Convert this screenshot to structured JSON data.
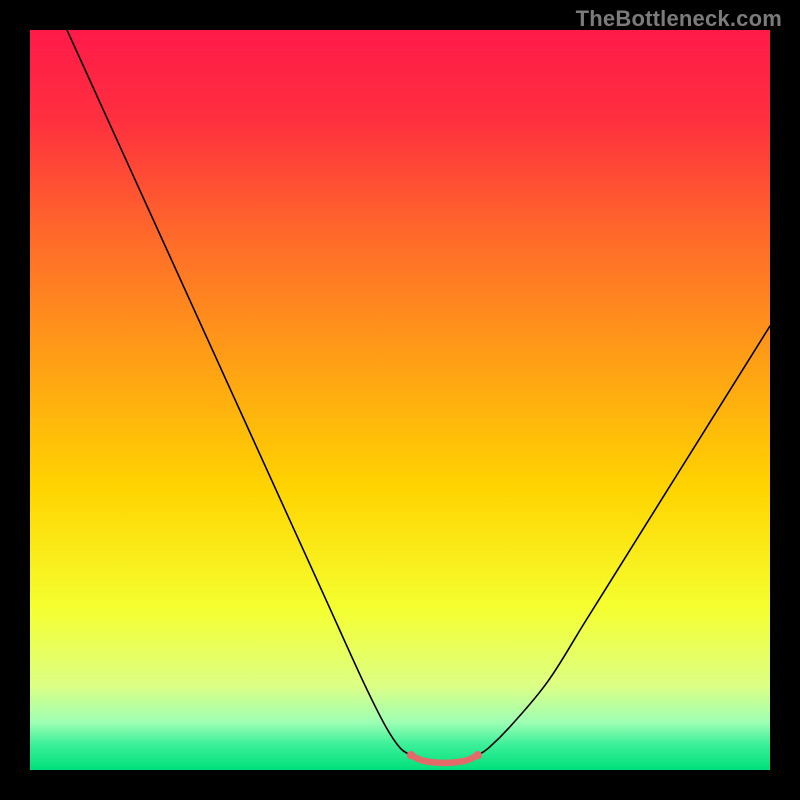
{
  "watermark": "TheBottleneck.com",
  "chart_data": {
    "type": "line",
    "title": "",
    "xlabel": "",
    "ylabel": "",
    "xlim": [
      0,
      100
    ],
    "ylim": [
      0,
      100
    ],
    "gradient_stops": [
      {
        "offset": 0.0,
        "color": "#ff1a49"
      },
      {
        "offset": 0.12,
        "color": "#ff2f3f"
      },
      {
        "offset": 0.28,
        "color": "#ff6a2a"
      },
      {
        "offset": 0.45,
        "color": "#ffa015"
      },
      {
        "offset": 0.62,
        "color": "#ffd400"
      },
      {
        "offset": 0.78,
        "color": "#f5ff2f"
      },
      {
        "offset": 0.885,
        "color": "#ddff84"
      },
      {
        "offset": 0.935,
        "color": "#9fffb4"
      },
      {
        "offset": 0.965,
        "color": "#3df09a"
      },
      {
        "offset": 1.0,
        "color": "#00e07a"
      }
    ],
    "series": [
      {
        "name": "bottleneck-curve-left",
        "color": "#000000",
        "width": 1.6,
        "x": [
          5,
          10,
          15,
          20,
          25,
          30,
          35,
          40,
          45,
          48,
          50,
          51.5
        ],
        "y": [
          100,
          89,
          78,
          67,
          56,
          45,
          34,
          23,
          12,
          6,
          3,
          2
        ]
      },
      {
        "name": "bottleneck-curve-right",
        "color": "#000000",
        "width": 1.6,
        "x": [
          60.5,
          62,
          65,
          70,
          75,
          80,
          85,
          90,
          95,
          100
        ],
        "y": [
          2,
          3,
          6,
          12,
          20,
          28,
          36,
          44,
          52,
          60
        ]
      },
      {
        "name": "sweet-spot-band",
        "color": "#e46a6a",
        "width": 6.5,
        "x": [
          51.5,
          53,
          55,
          57,
          59,
          60.5
        ],
        "y": [
          2,
          1.3,
          1,
          1,
          1.3,
          2
        ]
      }
    ],
    "markers": [
      {
        "x": 51.5,
        "y": 2,
        "r": 4.2,
        "color": "#e46a6a"
      },
      {
        "x": 60.5,
        "y": 2,
        "r": 4.2,
        "color": "#e46a6a"
      }
    ]
  }
}
